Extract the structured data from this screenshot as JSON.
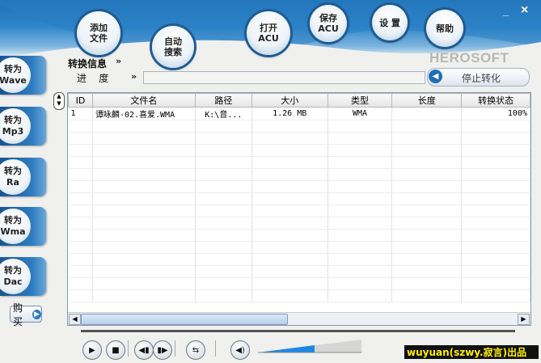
{
  "window": {
    "minimize": "_",
    "close": "×"
  },
  "brand": "HEROSOFT",
  "toolbar": [
    {
      "label": "添加\n文件"
    },
    {
      "label": "自动\n搜索"
    },
    {
      "label": "打开\nACU"
    },
    {
      "label": "保存\nACU"
    },
    {
      "label": "设 置"
    },
    {
      "label": "帮助"
    }
  ],
  "convert_buttons": [
    {
      "label": "转为\nWave"
    },
    {
      "label": "转为\nMp3"
    },
    {
      "label": "转为\nRa"
    },
    {
      "label": "转为\nWma"
    },
    {
      "label": "转为\nDac"
    }
  ],
  "buy_label": "购买",
  "info": {
    "title": "转换信息",
    "progress_label": "进    度"
  },
  "stop_button": "停止转化",
  "table": {
    "columns": [
      "ID",
      "文件名",
      "路径",
      "大小",
      "类型",
      "长度",
      "转换状态"
    ],
    "rows": [
      [
        "1",
        "谭咏麟-02.喜爱.WMA",
        "K:\\音...",
        "1.26 MB",
        "WMA",
        "",
        "100%"
      ]
    ]
  },
  "credit": "wuyuan(szwy.寂言)出品",
  "colors": {
    "header_blue": "#1f6fb3",
    "accent": "#2f7cc0"
  }
}
